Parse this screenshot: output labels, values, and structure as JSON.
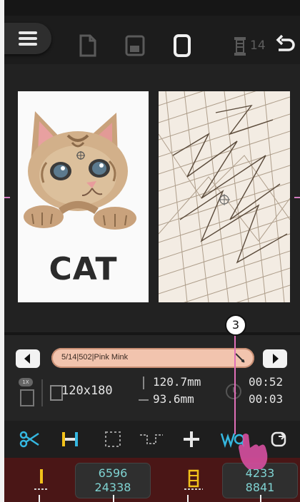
{
  "topbar": {
    "icons": [
      "menu-icon",
      "new-file-icon",
      "save-icon",
      "frame-icon",
      "needle-thread-icon",
      "undo-icon"
    ],
    "needle_count": "14"
  },
  "preview": {
    "design_text": "CAT"
  },
  "info": {
    "thread_info": "5/14|502|Pink Mink",
    "hoop_size": "120x180",
    "width": "120.7mm",
    "height": "93.6mm",
    "time_total": "00:52",
    "time_remaining": "00:03",
    "badge": "1X"
  },
  "tools": [
    "scissors-icon",
    "split-icon",
    "select-icon",
    "connect-icon",
    "move-icon",
    "wq-icon",
    "exit-icon"
  ],
  "counters": {
    "stitch_a": "6596",
    "stitch_b": "24338",
    "thread_a": "4233",
    "thread_b": "8841"
  },
  "callout": {
    "number": "3"
  },
  "colors": {
    "accent_cyan": "#7fd3d2",
    "pink": "#e06fb8",
    "bottom_bar": "#4a1616"
  }
}
